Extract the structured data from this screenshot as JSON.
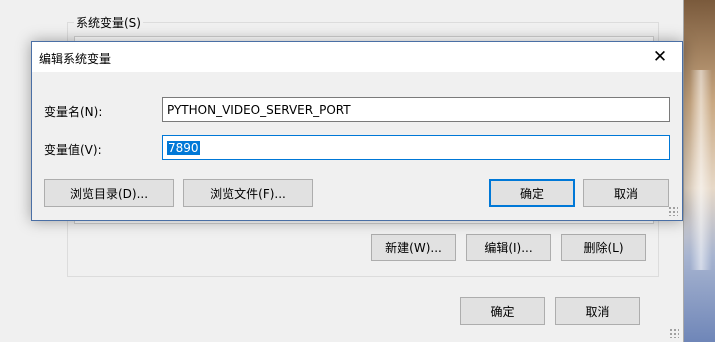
{
  "parent": {
    "group_label": "系统变量(S)",
    "buttons": {
      "new": "新建(W)...",
      "edit": "编辑(I)...",
      "delete": "删除(L)",
      "ok": "确定",
      "cancel": "取消"
    }
  },
  "dialog": {
    "title": "编辑系统变量",
    "close_glyph": "✕",
    "name_label": "变量名(N):",
    "name_value": "PYTHON_VIDEO_SERVER_PORT",
    "value_label": "变量值(V):",
    "value_value": "7890",
    "buttons": {
      "browse_dir": "浏览目录(D)...",
      "browse_file": "浏览文件(F)...",
      "ok": "确定",
      "cancel": "取消"
    }
  },
  "colors": {
    "accent": "#0078d7",
    "window_bg": "#f0f0f0",
    "button_bg": "#e1e1e1"
  }
}
